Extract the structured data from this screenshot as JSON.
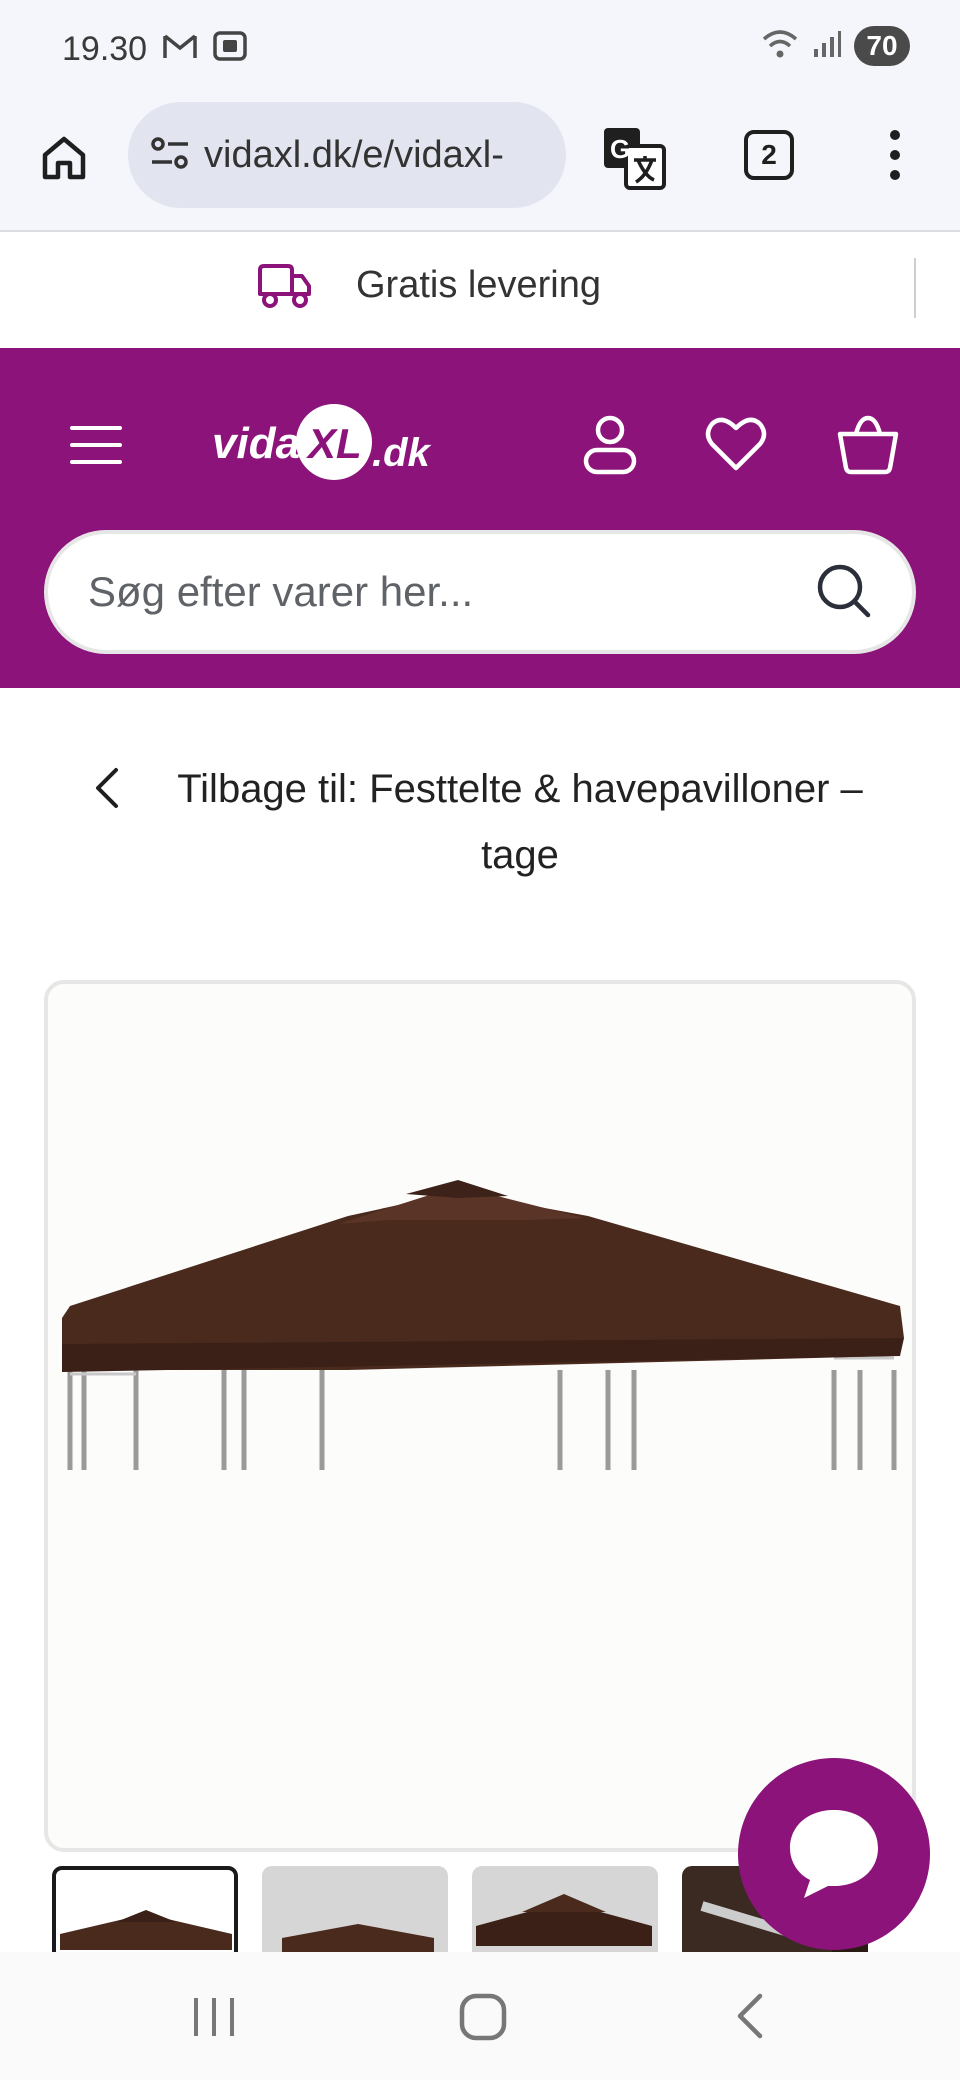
{
  "status_bar": {
    "time": "19.30",
    "battery": "70",
    "icons": [
      "gmail-icon",
      "screenshot-icon",
      "wifi-icon",
      "signal-icon",
      "battery-icon"
    ]
  },
  "browser": {
    "url": "vidaxl.dk/e/vidaxl-",
    "tab_count": "2"
  },
  "promo": {
    "text": "Gratis levering"
  },
  "header": {
    "logo_text": "vidaXL.dk",
    "search_placeholder": "Søg efter varer her..."
  },
  "breadcrumb": {
    "back_text": "Tilbage til: Festtelte & havepavilloner – tage"
  },
  "product": {
    "image_description_icon": "gazebo-roof-image",
    "roof_color": "#4b2a1e",
    "thumbnail_count": 4
  },
  "colors": {
    "brand": "#8c1379",
    "background": "#ffffff",
    "chrome": "#f5f6fb"
  },
  "nav": {
    "items": [
      "recent-apps-icon",
      "home-icon",
      "back-icon"
    ]
  }
}
